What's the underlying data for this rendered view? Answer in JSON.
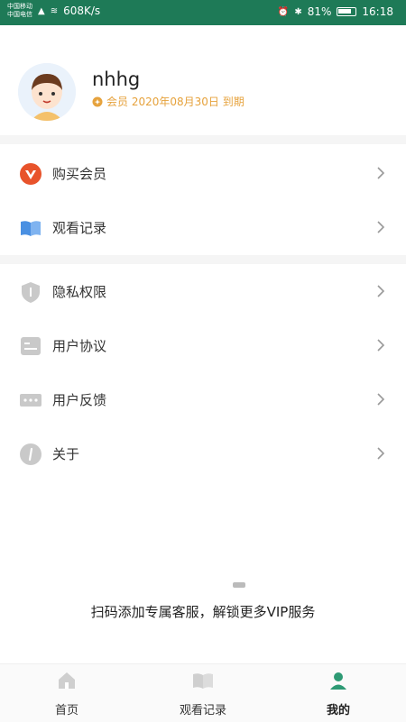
{
  "status_bar": {
    "carrier1": "中国移动",
    "carrier2": "中国电信",
    "network": "608K/s",
    "battery_percent": "81%",
    "battery_level": 0.81,
    "time": "16:18"
  },
  "profile": {
    "username": "nhhg",
    "member_text": "会员 2020年08月30日 到期"
  },
  "menu_group1": [
    {
      "label": "购买会员",
      "icon": "vip-icon"
    },
    {
      "label": "观看记录",
      "icon": "book-icon"
    }
  ],
  "menu_group2": [
    {
      "label": "隐私权限",
      "icon": "shield-icon"
    },
    {
      "label": "用户协议",
      "icon": "document-icon"
    },
    {
      "label": "用户反馈",
      "icon": "chat-icon"
    },
    {
      "label": "关于",
      "icon": "info-icon"
    }
  ],
  "promo_text": "扫码添加专属客服，解锁更多VIP服务",
  "tabbar": {
    "tabs": [
      {
        "label": "首页",
        "icon": "home-icon",
        "active": false
      },
      {
        "label": "观看记录",
        "icon": "book-icon",
        "active": false
      },
      {
        "label": "我的",
        "icon": "person-icon",
        "active": true
      }
    ]
  },
  "colors": {
    "brand_green": "#1e7a57",
    "member_gold": "#e6a23c",
    "vip_orange": "#e8532b",
    "active_tab": "#2e9a74"
  }
}
